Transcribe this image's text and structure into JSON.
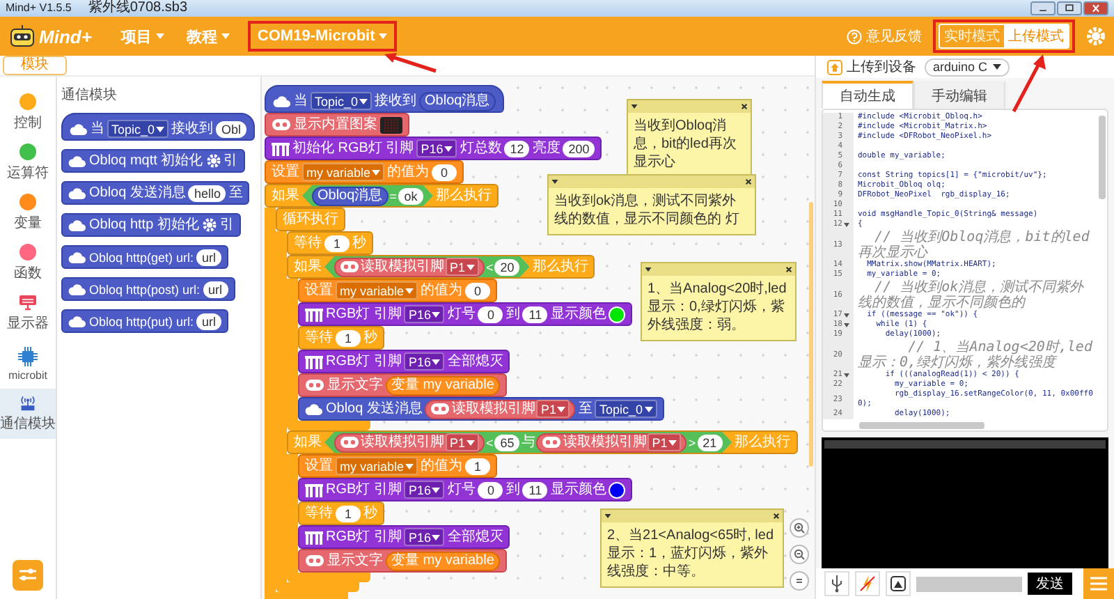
{
  "window": {
    "title": "Mind+ V1.5.5",
    "file": "紫外线0708.sb3"
  },
  "menu": {
    "logo": "Mind+",
    "items": [
      {
        "label": "项目",
        "annotated": false
      },
      {
        "label": "教程",
        "annotated": false
      },
      {
        "label": "COM19-Microbit",
        "annotated": true
      }
    ]
  },
  "feedback": "意见反馈",
  "mode_switch": {
    "annotated": true,
    "options": [
      {
        "label": "实时模式",
        "selected": false
      },
      {
        "label": "上传模式",
        "selected": true
      }
    ]
  },
  "tabs": [
    {
      "label": "模块",
      "selected": true
    }
  ],
  "categories": [
    {
      "label": "控制",
      "kind": "dot",
      "color": "#ffab19",
      "selected": false
    },
    {
      "label": "运算符",
      "kind": "dot",
      "color": "#40bf4a",
      "selected": false
    },
    {
      "label": "变量",
      "kind": "dot",
      "color": "#ff8c1a",
      "selected": false
    },
    {
      "label": "函数",
      "kind": "dot",
      "color": "#ff6680",
      "selected": false
    },
    {
      "label": "显示器",
      "kind": "display",
      "selected": false
    },
    {
      "label": "microbit",
      "kind": "chip",
      "selected": false
    },
    {
      "label": "通信模块",
      "kind": "antenna",
      "selected": true
    }
  ],
  "palette": {
    "title": "通信模块",
    "blocks": [
      {
        "kind": "event",
        "parts": [
          {
            "kind": "label",
            "text": "当"
          },
          {
            "kind": "dropdown",
            "text": "Topic_0"
          },
          {
            "kind": "label",
            "text": "接收到"
          },
          {
            "kind": "number",
            "text": "Obl"
          }
        ]
      },
      {
        "kind": "obloq",
        "parts": [
          {
            "kind": "label",
            "text": "Obloq mqtt 初始化"
          },
          {
            "kind": "gear"
          },
          {
            "kind": "label",
            "text": "引"
          }
        ]
      },
      {
        "kind": "obloq",
        "parts": [
          {
            "kind": "label",
            "text": "Obloq 发送消息"
          },
          {
            "kind": "number",
            "text": "hello"
          },
          {
            "kind": "label",
            "text": "至"
          }
        ]
      },
      {
        "kind": "obloq",
        "parts": [
          {
            "kind": "label",
            "text": "Obloq http 初始化"
          },
          {
            "kind": "gear"
          },
          {
            "kind": "label",
            "text": "引"
          }
        ]
      },
      {
        "kind": "obloq",
        "parts": [
          {
            "kind": "label",
            "text": "Obloq http(get) url:"
          },
          {
            "kind": "number",
            "text": "url"
          }
        ]
      },
      {
        "kind": "obloq",
        "parts": [
          {
            "kind": "label",
            "text": "Obloq http(post) url:"
          },
          {
            "kind": "number",
            "text": "url"
          }
        ]
      },
      {
        "kind": "obloq",
        "parts": [
          {
            "kind": "label",
            "text": "Obloq http(put) url:"
          },
          {
            "kind": "number",
            "text": "url"
          }
        ]
      }
    ]
  },
  "script": [
    {
      "kind": "event",
      "parts": [
        {
          "kind": "label",
          "text": "当"
        },
        {
          "kind": "dropdown",
          "text": "Topic_0"
        },
        {
          "kind": "label",
          "text": "接收到"
        },
        {
          "kind": "message",
          "parts": [
            {
              "kind": "label",
              "text": "Obloq消息"
            }
          ]
        }
      ]
    },
    {
      "kind": "display",
      "parts": [
        {
          "kind": "label",
          "text": "显示内置图案"
        },
        {
          "kind": "matrix"
        }
      ]
    },
    {
      "kind": "rgb",
      "parts": [
        {
          "kind": "label",
          "text": "初始化 RGB灯 引脚"
        },
        {
          "kind": "dropdown",
          "text": "P16"
        },
        {
          "kind": "label",
          "text": "灯总数"
        },
        {
          "kind": "number",
          "text": "12"
        },
        {
          "kind": "label",
          "text": "亮度"
        },
        {
          "kind": "number",
          "text": "200"
        }
      ]
    },
    {
      "kind": "variable",
      "parts": [
        {
          "kind": "label",
          "text": "设置"
        },
        {
          "kind": "dropdown",
          "text": "my variable"
        },
        {
          "kind": "label",
          "text": "的值为"
        },
        {
          "kind": "number",
          "text": "0"
        }
      ]
    },
    {
      "kind": "control",
      "parts": [
        {
          "kind": "label",
          "text": "如果"
        },
        {
          "kind": "condition",
          "parts": [
            {
              "kind": "message",
              "parts": [
                {
                  "kind": "label",
                  "text": "Obloq消息"
                }
              ]
            },
            {
              "kind": "label",
              "text": "="
            },
            {
              "kind": "number",
              "text": "ok"
            }
          ]
        },
        {
          "kind": "label",
          "text": "那么执行"
        }
      ],
      "children": [
        {
          "kind": "control",
          "parts": [
            {
              "kind": "label",
              "text": "循环执行"
            }
          ],
          "children": [
            {
              "kind": "control",
              "parts": [
                {
                  "kind": "label",
                  "text": "等待"
                },
                {
                  "kind": "number",
                  "text": "1"
                },
                {
                  "kind": "label",
                  "text": "秒"
                }
              ]
            },
            {
              "kind": "control",
              "parts": [
                {
                  "kind": "label",
                  "text": "如果"
                },
                {
                  "kind": "condition",
                  "parts": [
                    {
                      "kind": "pin",
                      "parts": [
                        {
                          "kind": "label",
                          "text": "读取模拟引脚"
                        },
                        {
                          "kind": "dropdown",
                          "text": "P1"
                        }
                      ]
                    },
                    {
                      "kind": "label",
                      "text": "<"
                    },
                    {
                      "kind": "number",
                      "text": "20"
                    }
                  ]
                },
                {
                  "kind": "label",
                  "text": "那么执行"
                }
              ],
              "children": [
                {
                  "kind": "variable",
                  "parts": [
                    {
                      "kind": "label",
                      "text": "设置"
                    },
                    {
                      "kind": "dropdown",
                      "text": "my variable"
                    },
                    {
                      "kind": "label",
                      "text": "的值为"
                    },
                    {
                      "kind": "number",
                      "text": "0"
                    }
                  ]
                },
                {
                  "kind": "rgb",
                  "parts": [
                    {
                      "kind": "label",
                      "text": "RGB灯 引脚"
                    },
                    {
                      "kind": "dropdown",
                      "text": "P16"
                    },
                    {
                      "kind": "label",
                      "text": "灯号"
                    },
                    {
                      "kind": "number",
                      "text": "0"
                    },
                    {
                      "kind": "label",
                      "text": "到"
                    },
                    {
                      "kind": "number",
                      "text": "11"
                    },
                    {
                      "kind": "label",
                      "text": "显示颜色"
                    },
                    {
                      "kind": "swatch",
                      "color": "#00e600"
                    }
                  ]
                },
                {
                  "kind": "control",
                  "parts": [
                    {
                      "kind": "label",
                      "text": "等待"
                    },
                    {
                      "kind": "number",
                      "text": "1"
                    },
                    {
                      "kind": "label",
                      "text": "秒"
                    }
                  ]
                },
                {
                  "kind": "rgb",
                  "parts": [
                    {
                      "kind": "label",
                      "text": "RGB灯 引脚"
                    },
                    {
                      "kind": "dropdown",
                      "text": "P16"
                    },
                    {
                      "kind": "label",
                      "text": "全部熄灭"
                    }
                  ]
                },
                {
                  "kind": "display",
                  "parts": [
                    {
                      "kind": "label",
                      "text": "显示文字"
                    },
                    {
                      "kind": "variable",
                      "parts": [
                        {
                          "kind": "label",
                          "text": "变量 my variable"
                        }
                      ]
                    }
                  ]
                },
                {
                  "kind": "obloq",
                  "parts": [
                    {
                      "kind": "label",
                      "text": "Obloq 发送消息"
                    },
                    {
                      "kind": "pin",
                      "parts": [
                        {
                          "kind": "label",
                          "text": "读取模拟引脚"
                        },
                        {
                          "kind": "dropdown",
                          "text": "P1"
                        }
                      ]
                    },
                    {
                      "kind": "label",
                      "text": "至"
                    },
                    {
                      "kind": "dropdown",
                      "text": "Topic_0"
                    }
                  ]
                }
              ]
            },
            {
              "kind": "control",
              "parts": [
                {
                  "kind": "label",
                  "text": "如果"
                },
                {
                  "kind": "condition",
                  "parts": [
                    {
                      "kind": "pin",
                      "parts": [
                        {
                          "kind": "label",
                          "text": "读取模拟引脚"
                        },
                        {
                          "kind": "dropdown",
                          "text": "P1"
                        }
                      ]
                    },
                    {
                      "kind": "label",
                      "text": "<"
                    },
                    {
                      "kind": "number",
                      "text": "65"
                    },
                    {
                      "kind": "label",
                      "text": "与"
                    },
                    {
                      "kind": "pin",
                      "parts": [
                        {
                          "kind": "label",
                          "text": "读取模拟引脚"
                        },
                        {
                          "kind": "dropdown",
                          "text": "P1"
                        }
                      ]
                    },
                    {
                      "kind": "label",
                      "text": ">"
                    },
                    {
                      "kind": "number",
                      "text": "21"
                    }
                  ]
                },
                {
                  "kind": "label",
                  "text": "那么执行"
                }
              ],
              "children": [
                {
                  "kind": "variable",
                  "parts": [
                    {
                      "kind": "label",
                      "text": "设置"
                    },
                    {
                      "kind": "dropdown",
                      "text": "my variable"
                    },
                    {
                      "kind": "label",
                      "text": "的值为"
                    },
                    {
                      "kind": "number",
                      "text": "1"
                    }
                  ]
                },
                {
                  "kind": "rgb",
                  "parts": [
                    {
                      "kind": "label",
                      "text": "RGB灯 引脚"
                    },
                    {
                      "kind": "dropdown",
                      "text": "P16"
                    },
                    {
                      "kind": "label",
                      "text": "灯号"
                    },
                    {
                      "kind": "number",
                      "text": "0"
                    },
                    {
                      "kind": "label",
                      "text": "到"
                    },
                    {
                      "kind": "number",
                      "text": "11"
                    },
                    {
                      "kind": "label",
                      "text": "显示颜色"
                    },
                    {
                      "kind": "swatch",
                      "color": "#0000f0"
                    }
                  ]
                },
                {
                  "kind": "control",
                  "parts": [
                    {
                      "kind": "label",
                      "text": "等待"
                    },
                    {
                      "kind": "number",
                      "text": "1"
                    },
                    {
                      "kind": "label",
                      "text": "秒"
                    }
                  ]
                },
                {
                  "kind": "rgb",
                  "parts": [
                    {
                      "kind": "label",
                      "text": "RGB灯 引脚"
                    },
                    {
                      "kind": "dropdown",
                      "text": "P16"
                    },
                    {
                      "kind": "label",
                      "text": "全部熄灭"
                    }
                  ]
                },
                {
                  "kind": "display",
                  "parts": [
                    {
                      "kind": "label",
                      "text": "显示文字"
                    },
                    {
                      "kind": "variable",
                      "parts": [
                        {
                          "kind": "label",
                          "text": "变量 my variable"
                        }
                      ]
                    }
                  ]
                }
              ]
            }
          ]
        }
      ]
    }
  ],
  "notes": [
    {
      "text": "当收到Obloq消息，bit的led再次显示心"
    },
    {
      "text": "当收到ok消息，测试不同紫外线的数值，显示不同颜色的 灯"
    },
    {
      "text": "1、当Analog<20时,led显示：0,绿灯闪烁，紫外线强度：弱。"
    },
    {
      "text": "2、当21<Analog<65时, led显示：1，蓝灯闪烁，紫外线强度：中等。"
    }
  ],
  "upload": {
    "label": "上传到设备",
    "target": "arduino C"
  },
  "editor": {
    "tabs": [
      {
        "label": "自动生成",
        "selected": true
      },
      {
        "label": "手动编辑",
        "selected": false
      }
    ],
    "lines": [
      {
        "num": "1",
        "kind": "code",
        "fold": false,
        "text": "#include <Microbit_Obloq.h>"
      },
      {
        "num": "2",
        "kind": "code",
        "fold": false,
        "text": "#include <Microbit_Matrix.h>"
      },
      {
        "num": "3",
        "kind": "code",
        "fold": false,
        "text": "#include <DFRobot_NeoPixel.h>"
      },
      {
        "num": "4",
        "fold": false
      },
      {
        "num": "5",
        "kind": "code",
        "fold": false,
        "text": "double my_variable;"
      },
      {
        "num": "6",
        "fold": false
      },
      {
        "num": "7",
        "kind": "code",
        "fold": false,
        "text": "const String topics[1] = {\"microbit/uv\"};"
      },
      {
        "num": "8",
        "kind": "code",
        "fold": false,
        "text": "Microbit_Obloq olq;"
      },
      {
        "num": "9",
        "kind": "code",
        "fold": false,
        "text": "DFRobot_NeoPixel  rgb_display_16;"
      },
      {
        "num": "10",
        "fold": false
      },
      {
        "num": "11",
        "kind": "code",
        "fold": false,
        "text": "void msgHandle_Topic_0(String& message)"
      },
      {
        "num": "12",
        "kind": "code",
        "fold": true,
        "text": "{"
      },
      {
        "num": "13",
        "kind": "comment",
        "fold": false,
        "text": "  // 当收到Obloq消息，bit的led再次显示心"
      },
      {
        "num": "14",
        "kind": "code",
        "fold": false,
        "text": "  MMatrix.show(MMatrix.HEART);"
      },
      {
        "num": "15",
        "kind": "code",
        "fold": false,
        "text": "  my_variable = 0;"
      },
      {
        "num": "16",
        "kind": "comment",
        "fold": false,
        "text": "  // 当收到ok消息，测试不同紫外线的数值，显示不同颜色的"
      },
      {
        "num": "17",
        "kind": "code",
        "fold": true,
        "text": "  if ((message == \"ok\")) {"
      },
      {
        "num": "18",
        "kind": "code",
        "fold": true,
        "text": "    while (1) {"
      },
      {
        "num": "19",
        "kind": "code",
        "fold": false,
        "text": "      delay(1000);"
      },
      {
        "num": "20",
        "kind": "comment",
        "fold": false,
        "text": "      // 1、当Analog<20时,led显示：0,绿灯闪烁，紫外线强度"
      },
      {
        "num": "21",
        "kind": "code",
        "fold": true,
        "text": "      if (((analogRead(1)) < 20)) {"
      },
      {
        "num": "22",
        "kind": "code",
        "fold": false,
        "text": "        my_variable = 0;"
      },
      {
        "num": "23",
        "kind": "code",
        "fold": false,
        "text": "        rgb_display_16.setRangeColor(0, 11, 0x00ff00);"
      },
      {
        "num": "24",
        "kind": "code",
        "fold": false,
        "text": "        delay(1000);"
      }
    ]
  },
  "serial": {
    "send": "发送"
  }
}
